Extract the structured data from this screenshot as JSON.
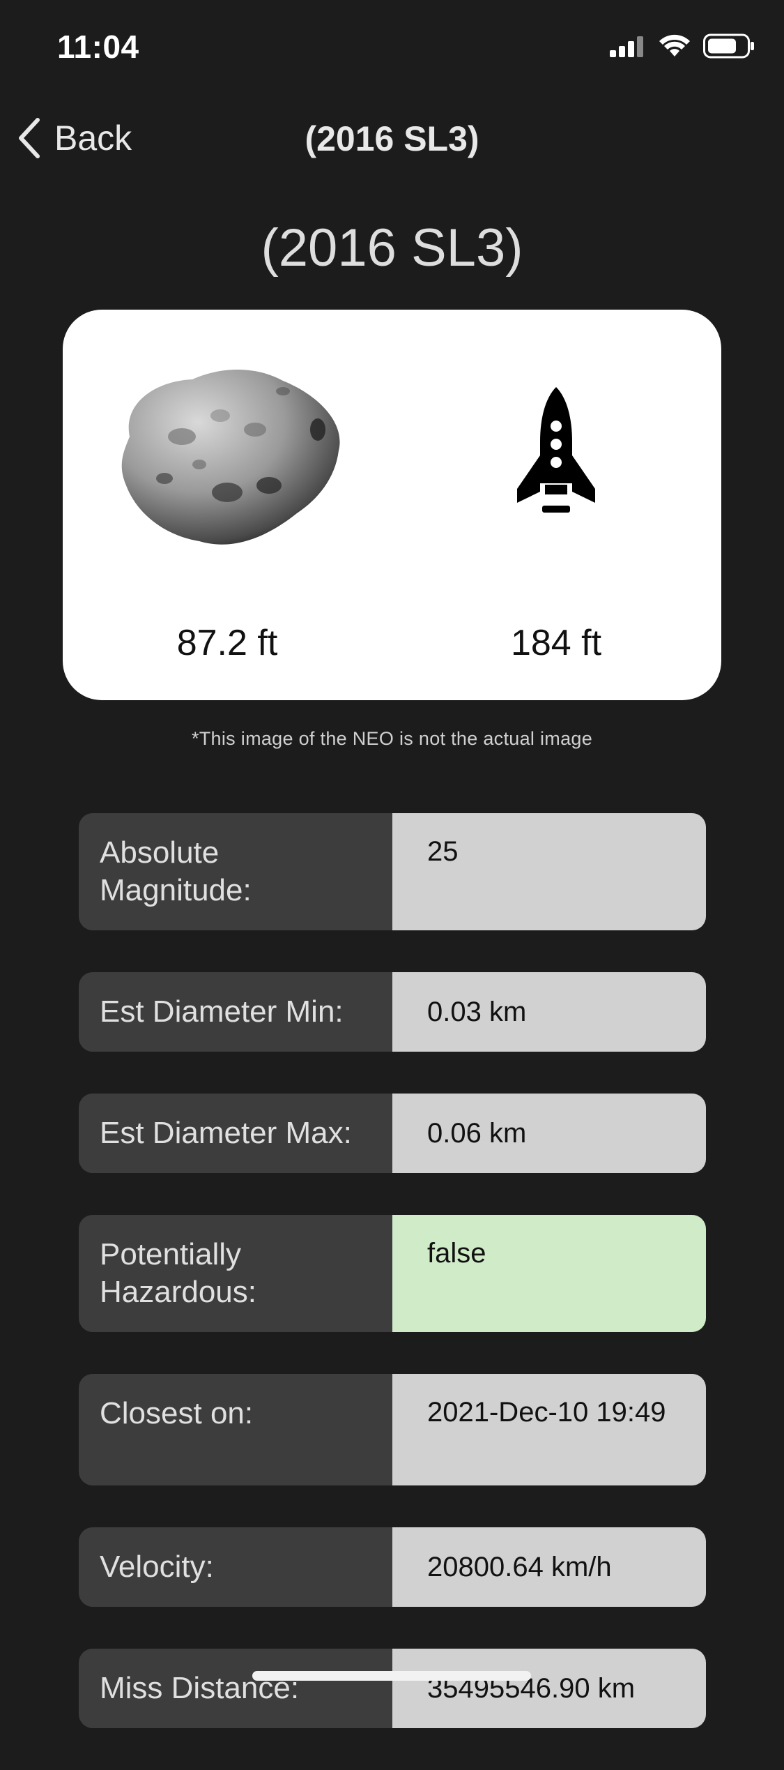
{
  "status_bar": {
    "time": "11:04"
  },
  "nav": {
    "back_label": "Back",
    "title": "(2016 SL3)"
  },
  "heading": "(2016 SL3)",
  "comparison": {
    "asteroid_size": "87.2 ft",
    "rocket_size": "184 ft",
    "disclaimer": "*This image of the NEO is not the actual image"
  },
  "details": [
    {
      "label": "Absolute Magnitude:",
      "value": "25"
    },
    {
      "label": "Est Diameter Min:",
      "value": "0.03 km"
    },
    {
      "label": "Est Diameter Max:",
      "value": "0.06 km"
    },
    {
      "label": "Potentially Hazardous:",
      "value": "false"
    },
    {
      "label": "Closest on:",
      "value": "2021-Dec-10 19:49"
    },
    {
      "label": "Velocity:",
      "value": "20800.64 km/h"
    },
    {
      "label": "Miss Distance:",
      "value": "35495546.90 km"
    }
  ],
  "colors": {
    "background": "#1c1c1c",
    "label_cell": "#3d3d3d",
    "value_cell": "#d1d1d1",
    "safe_value_cell": "#d0ebc8"
  }
}
